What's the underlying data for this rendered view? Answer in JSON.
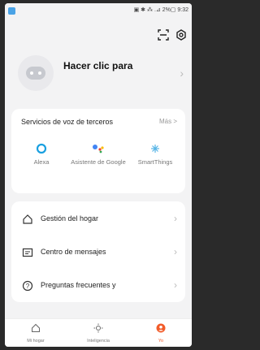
{
  "status_bar": {
    "right_text": "▣ ✱ ⁂ .⊿ 2%▢ 9:32"
  },
  "profile": {
    "title": "Hacer clic para"
  },
  "voice_services": {
    "title": "Servicios de voz de terceros",
    "more": "Más >",
    "items": [
      {
        "label": "Alexa",
        "icon": "alexa-icon"
      },
      {
        "label": "Asistente de Google",
        "icon": "google-assistant-icon"
      },
      {
        "label": "SmartThings",
        "icon": "smartthings-icon"
      }
    ]
  },
  "menu": {
    "items": [
      {
        "label": "Gestión del hogar",
        "icon": "home-icon"
      },
      {
        "label": "Centro de mensajes",
        "icon": "message-icon"
      },
      {
        "label": "Preguntas frecuentes y",
        "icon": "help-icon"
      }
    ]
  },
  "tabbar": {
    "tabs": [
      {
        "label": "Mi hogar",
        "icon": "home-icon",
        "active": false
      },
      {
        "label": "Inteligencia",
        "icon": "sun-icon",
        "active": false
      },
      {
        "label": "Yo",
        "icon": "user-icon",
        "active": true
      }
    ]
  },
  "colors": {
    "accent": "#f25c2a",
    "alexa": "#1aa0e0",
    "background": "#f3f3f4"
  }
}
